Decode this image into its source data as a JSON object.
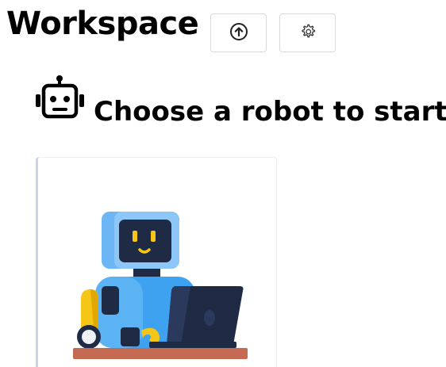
{
  "header": {
    "title": "Workspace",
    "upload_icon": "arrow-up-circle-icon",
    "settings_icon": "gear-icon"
  },
  "section": {
    "heading": "Choose a robot to start",
    "heading_icon": "robot-head-icon"
  },
  "robots": [
    {
      "illustration": "robot-at-laptop-illustration"
    }
  ],
  "colors": {
    "robot_blue": "#3fa2f0",
    "robot_head": "#6cb6f5",
    "robot_dark": "#1f2a44",
    "robot_yellow": "#f5c518",
    "desk": "#c56a52"
  }
}
